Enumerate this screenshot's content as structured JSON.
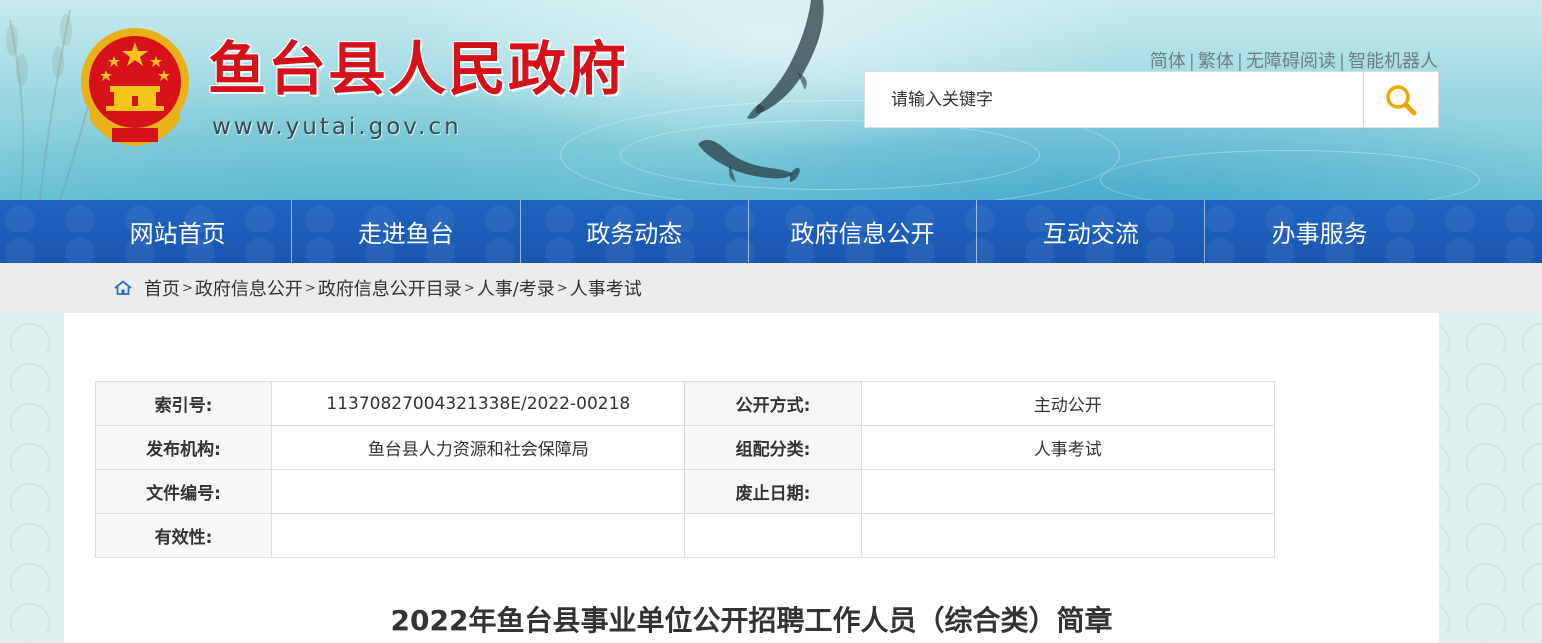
{
  "header": {
    "site_title": "鱼台县人民政府",
    "site_url": "www.yutai.gov.cn",
    "top_links": [
      "简体",
      "繁体",
      "无障碍阅读",
      "智能机器人"
    ],
    "search_placeholder": "请输入关键字",
    "title_color": "#d7111a"
  },
  "nav": {
    "items": [
      "网站首页",
      "走进鱼台",
      "政务动态",
      "政府信息公开",
      "互动交流",
      "办事服务"
    ],
    "color": "#1a56b0"
  },
  "breadcrumb": {
    "items": [
      "首页",
      "政府信息公开",
      "政府信息公开目录",
      "人事/考录",
      "人事考试"
    ],
    "separator": ">"
  },
  "meta_table": {
    "rows": [
      {
        "label1": "索引号:",
        "value1": "11370827004321338E/2022-00218",
        "label2": "公开方式:",
        "value2": "主动公开"
      },
      {
        "label1": "发布机构:",
        "value1": "鱼台县人力资源和社会保障局",
        "label2": "组配分类:",
        "value2": "人事考试"
      },
      {
        "label1": "文件编号:",
        "value1": "",
        "label2": "废止日期:",
        "value2": ""
      },
      {
        "label1": "有效性:",
        "value1": "",
        "label2": "",
        "value2": ""
      }
    ]
  },
  "article": {
    "title": "2022年鱼台县事业单位公开招聘工作人员（综合类）简章"
  },
  "icons": {
    "search": "search-icon",
    "home": "home-icon",
    "emblem": "national-emblem-icon"
  }
}
